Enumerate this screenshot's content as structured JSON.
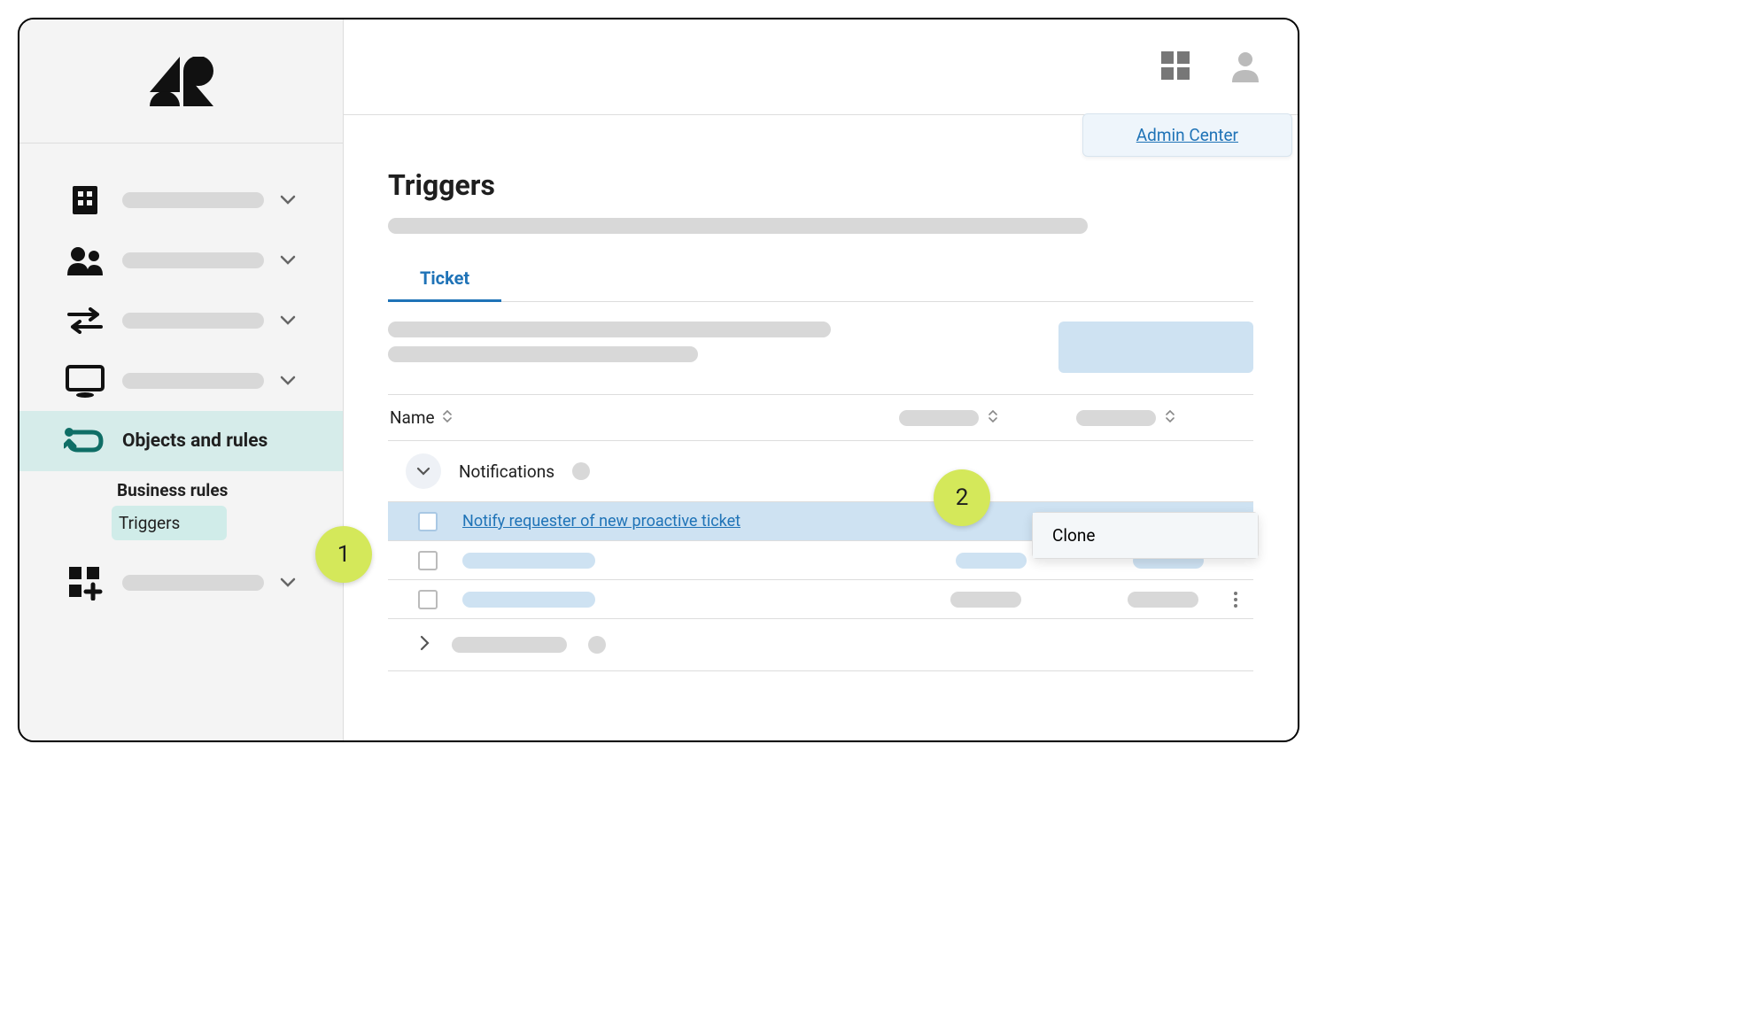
{
  "header": {
    "admin_center_label": "Admin Center"
  },
  "sidebar": {
    "items": [
      {
        "id": "company",
        "icon": "building-icon"
      },
      {
        "id": "people",
        "icon": "people-icon"
      },
      {
        "id": "workflow",
        "icon": "arrows-horizontal-icon"
      },
      {
        "id": "channels",
        "icon": "monitor-icon"
      },
      {
        "id": "objects",
        "icon": "route-icon",
        "label": "Objects and rules"
      },
      {
        "id": "apps",
        "icon": "apps-plus-icon"
      }
    ],
    "sub_section": {
      "heading": "Business rules",
      "active_item": "Triggers"
    }
  },
  "page": {
    "title": "Triggers",
    "tabs": [
      {
        "label": "Ticket",
        "active": true
      }
    ],
    "table": {
      "columns": {
        "name": "Name"
      },
      "group_label": "Notifications",
      "rows": [
        {
          "link": "Notify requester of new proactive ticket",
          "highlighted": true
        }
      ]
    },
    "context_menu": {
      "clone_label": "Clone"
    }
  },
  "steps": {
    "one": "1",
    "two": "2"
  }
}
